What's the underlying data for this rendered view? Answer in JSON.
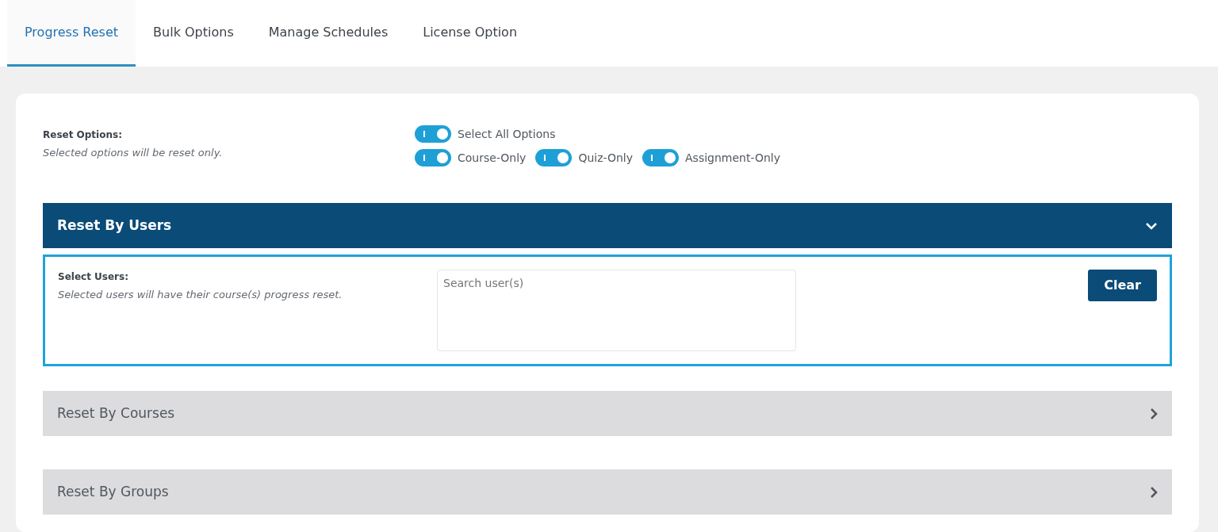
{
  "tabs": [
    {
      "label": "Progress Reset",
      "selected": true
    },
    {
      "label": "Bulk Options",
      "selected": false
    },
    {
      "label": "Manage Schedules",
      "selected": false
    },
    {
      "label": "License Option",
      "selected": false
    }
  ],
  "reset_options": {
    "label": "Reset Options:",
    "description": "Selected options will be reset only.",
    "toggles": [
      {
        "label": "Select All Options",
        "on": true
      },
      {
        "label": "Course-Only",
        "on": true
      },
      {
        "label": "Quiz-Only",
        "on": true
      },
      {
        "label": "Assignment-Only",
        "on": true
      }
    ]
  },
  "sections": [
    {
      "title": "Reset By Users",
      "expanded": true,
      "field_label": "Select Users:",
      "field_description": "Selected users will have their course(s) progress reset.",
      "search": {
        "placeholder": "Search user(s)"
      },
      "button": "Clear"
    },
    {
      "title": "Reset By Courses",
      "expanded": false
    },
    {
      "title": "Reset By Groups",
      "expanded": false
    }
  ]
}
